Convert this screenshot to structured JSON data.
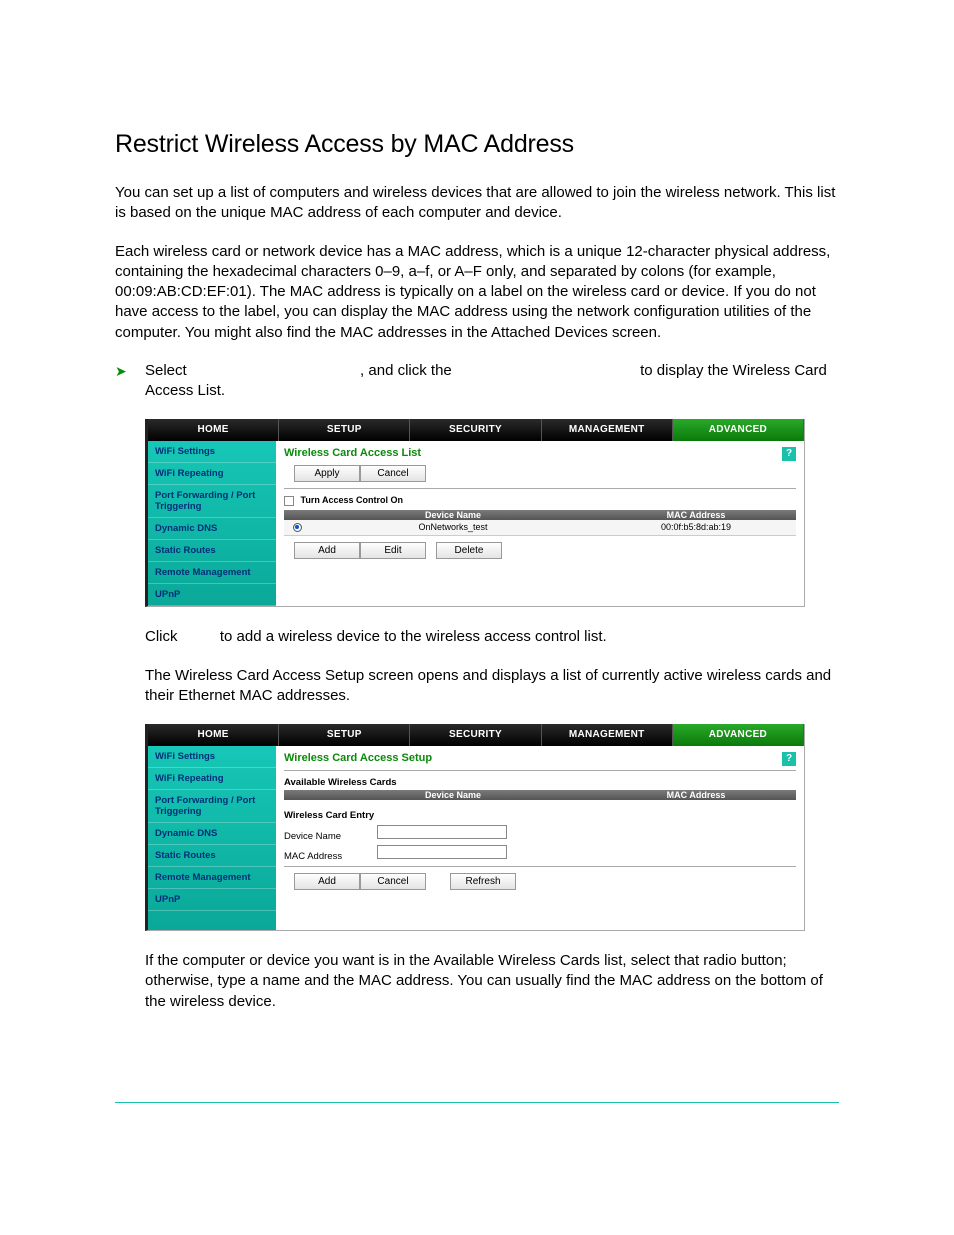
{
  "doc": {
    "heading": "Restrict Wireless Access by MAC Address",
    "p1": "You can set up a list of computers and wireless devices that are allowed to join the wireless network. This list is based on the unique MAC address of each computer and device.",
    "p2": "Each wireless card or network device has a MAC address, which is a unique 12-character physical address, containing the hexadecimal characters 0–9, a–f, or A–F only, and separated by colons (for example, 00:09:AB:CD:EF:01). The MAC address is typically on a label on the wireless card or device. If you do not have access to the label, you can display the MAC address using the network configuration utilities of the computer. You might also find the MAC addresses in the Attached Devices screen.",
    "stepA_before": "Select",
    "stepA_mid": ", and click the",
    "stepA_after": "to display the Wireless Card Access List.",
    "stepB_before": "Click",
    "stepB_after": "to add a wireless device to the wireless access control list.",
    "p3": "The Wireless Card Access Setup screen opens and displays a list of currently active wireless cards and their Ethernet MAC addresses.",
    "p4": "If the computer or device you want is in the Available Wireless Cards list, select that radio button; otherwise, type a name and the MAC address. You can usually find the MAC address on the bottom of the wireless device."
  },
  "router": {
    "tabs": [
      "HOME",
      "SETUP",
      "SECURITY",
      "MANAGEMENT",
      "ADVANCED"
    ],
    "activeTab": "ADVANCED",
    "sidebar": [
      "WiFi Settings",
      "WiFi Repeating",
      "Port Forwarding / Port Triggering",
      "Dynamic DNS",
      "Static Routes",
      "Remote Management",
      "UPnP"
    ],
    "screen1": {
      "title": "Wireless Card Access List",
      "apply": "Apply",
      "cancel": "Cancel",
      "toggle": "Turn Access Control On",
      "colDevice": "Device Name",
      "colMac": "MAC Address",
      "rowDevice": "OnNetworks_test",
      "rowMac": "00:0f:b5:8d:ab:19",
      "add": "Add",
      "edit": "Edit",
      "delete": "Delete"
    },
    "screen2": {
      "title": "Wireless Card Access Setup",
      "avail": "Available Wireless Cards",
      "colDevice": "Device Name",
      "colMac": "MAC Address",
      "entry": "Wireless Card Entry",
      "devName": "Device Name",
      "macAddr": "MAC Address",
      "add": "Add",
      "cancel": "Cancel",
      "refresh": "Refresh"
    },
    "helpGlyph": "?"
  }
}
